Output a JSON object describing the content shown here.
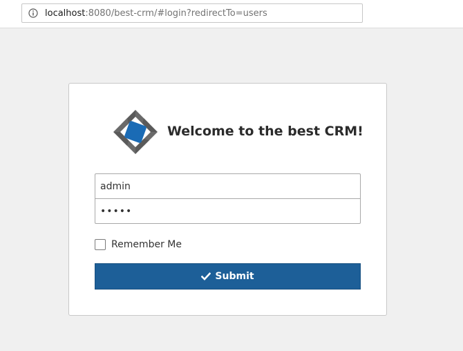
{
  "browser": {
    "url_host": "localhost",
    "url_rest": ":8080/best-crm/#login?redirectTo=users",
    "info_icon": "info-icon"
  },
  "login": {
    "logo_icon": "crm-logo",
    "title": "Welcome to the best CRM!",
    "username_value": "admin",
    "password_value": "•••••",
    "remember_label": "Remember Me",
    "remember_checked": false,
    "submit_icon": "check-icon",
    "submit_label": "Submit"
  },
  "colors": {
    "accent": "#1d5f98",
    "logo_blue": "#1a6bb5",
    "logo_gray": "#5a5a5a",
    "background": "#f0f0f0"
  }
}
